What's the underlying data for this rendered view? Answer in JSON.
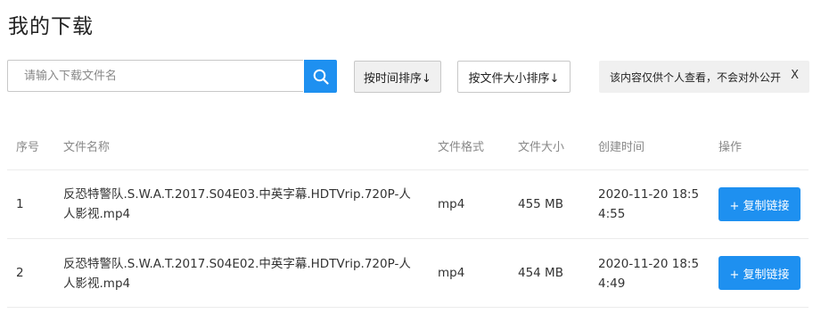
{
  "page": {
    "title": "我的下载"
  },
  "search": {
    "placeholder": "请输入下载文件名",
    "value": ""
  },
  "toolbar": {
    "sort_by_time": "按时间排序↓",
    "sort_by_size": "按文件大小排序↓"
  },
  "notice": {
    "text": "该内容仅供个人查看，不会对外公开",
    "close": "X"
  },
  "table": {
    "headers": {
      "index": "序号",
      "name": "文件名称",
      "format": "文件格式",
      "size": "文件大小",
      "created": "创建时间",
      "action": "操作"
    },
    "rows": [
      {
        "index": "1",
        "name": "反恐特警队.S.W.A.T.2017.S04E03.中英字幕.HDTVrip.720P-人人影视.mp4",
        "format": "mp4",
        "size": "455 MB",
        "created": "2020-11-20 18:54:55",
        "action": "+ 复制链接"
      },
      {
        "index": "2",
        "name": "反恐特警队.S.W.A.T.2017.S04E02.中英字幕.HDTVrip.720P-人人影视.mp4",
        "format": "mp4",
        "size": "454 MB",
        "created": "2020-11-20 18:54:49",
        "action": "+ 复制链接"
      }
    ]
  },
  "colors": {
    "accent": "#1e90f0",
    "muted": "#888888",
    "notice_bg": "#f0f0f0"
  },
  "icons": {
    "search": "search-icon",
    "close": "close-icon",
    "plus": "plus-icon"
  }
}
